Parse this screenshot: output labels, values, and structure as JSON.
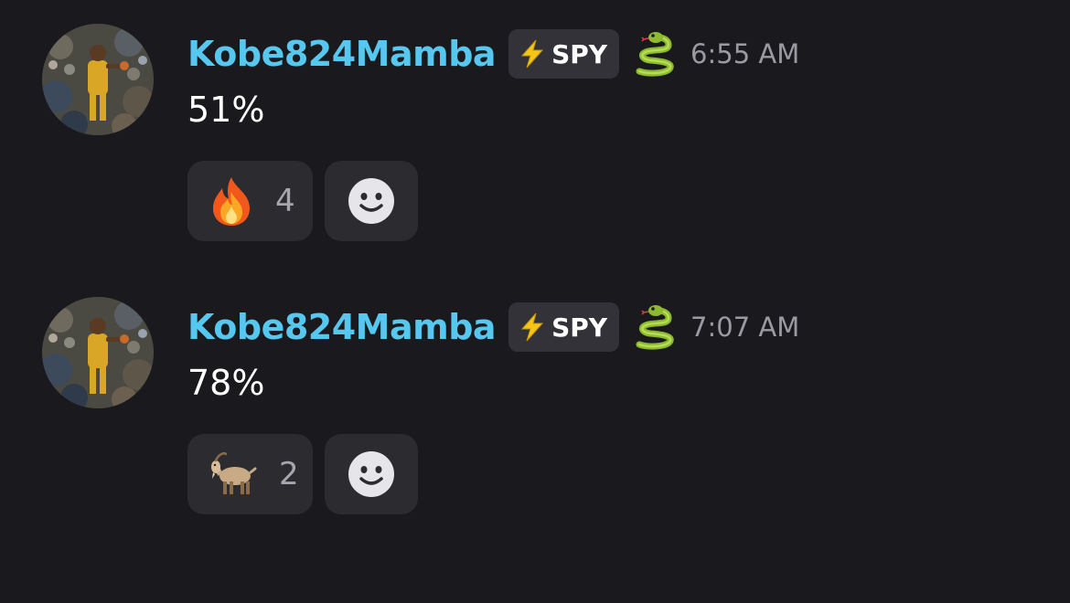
{
  "colors": {
    "background": "#1a1a1e",
    "username": "#56c8ef",
    "tag_background": "#323238",
    "reaction_background": "#2b2b30",
    "timestamp": "#9a9aa2"
  },
  "messages": [
    {
      "author": "Kobe824Mamba",
      "tag": {
        "icon": "lightning-icon",
        "label": "SPY"
      },
      "badge_icon": "snake-icon",
      "time": "6:55 AM",
      "content": "51%",
      "reactions": [
        {
          "emoji": "fire-icon",
          "count": "4"
        }
      ],
      "add_reaction_icon": "smiley-icon"
    },
    {
      "author": "Kobe824Mamba",
      "tag": {
        "icon": "lightning-icon",
        "label": "SPY"
      },
      "badge_icon": "snake-icon",
      "time": "7:07 AM",
      "content": "78%",
      "reactions": [
        {
          "emoji": "goat-icon",
          "count": "2"
        }
      ],
      "add_reaction_icon": "smiley-icon"
    }
  ]
}
